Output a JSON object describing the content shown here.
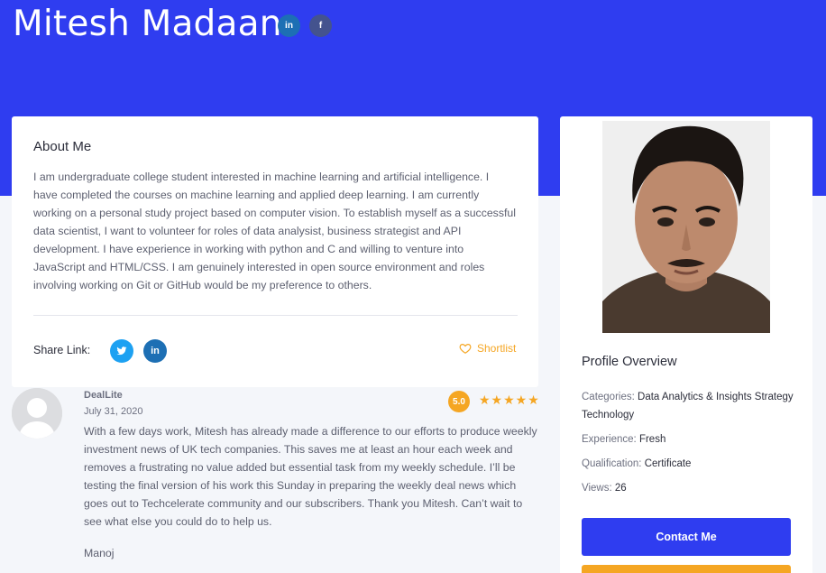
{
  "header": {
    "name": "Mitesh Madaan",
    "social": [
      {
        "icon": "linkedin-icon",
        "glyph": "in",
        "color": "#1d6fb4"
      },
      {
        "icon": "facebook-icon",
        "glyph": "f",
        "color": "#44538e"
      }
    ],
    "background_color": "#2f3df0"
  },
  "about": {
    "title": "About Me",
    "text": "I am undergraduate college student interested in machine learning and artificial intelligence. I have completed the courses on machine learning and applied deep learning. I am currently working on a personal study project based on computer vision. To establish myself as a successful data scientist, I want to volunteer for roles of data analysist, business strategist and API development.  I have experience in working with python and C and willing to venture into JavaScript and HTML/CSS. I am genuinely interested in open source environment and roles involving working on Git or GitHub would be my preference to others.",
    "share_label": "Share Link:",
    "share": [
      {
        "icon": "twitter-icon",
        "glyph": "t",
        "color": "#1da1f2"
      },
      {
        "icon": "linkedin-icon",
        "glyph": "in",
        "color": "#1d6fb4"
      }
    ],
    "shortlist_label": "Shortlist"
  },
  "review": {
    "author": "DealLite",
    "date": "July 31, 2020",
    "rating": "5.0",
    "stars": "★★★★★",
    "text": "With a few days work, Mitesh has already made a difference to our efforts to produce weekly investment news of UK tech companies. This saves me at least an hour each week and removes a frustrating no value added but essential task from my weekly schedule. I’ll be testing the final version of his work this Sunday in preparing the weekly deal news which goes out to Techcelerate community and our subscribers. Thank you Mitesh. Can’t wait to see what else you could do to help us.",
    "signature": "Manoj"
  },
  "profile": {
    "title": "Profile Overview",
    "categories_label": "Categories:",
    "categories_value": "Data Analytics & Insights",
    "categories_value2": "Strategy Technology",
    "experience_label": "Experience:",
    "experience_value": "Fresh",
    "qualification_label": "Qualification:",
    "qualification_value": "Certificate",
    "views_label": "Views:",
    "views_value": "26",
    "contact_label": "Contact Me"
  },
  "colors": {
    "accent": "#2f3df0",
    "highlight": "#f5a623"
  }
}
